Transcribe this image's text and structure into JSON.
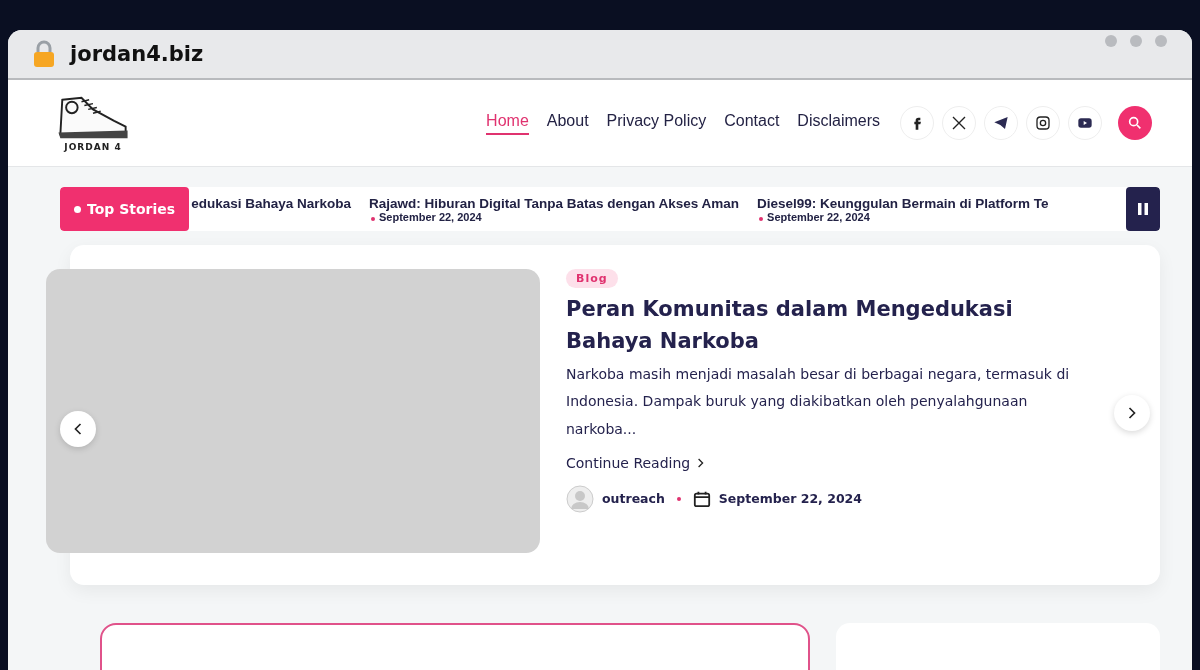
{
  "browser": {
    "address": "jordan4.biz"
  },
  "site": {
    "logo_text": "JORDAN 4"
  },
  "nav": [
    {
      "label": "Home",
      "selected": true
    },
    {
      "label": "About",
      "selected": false
    },
    {
      "label": "Privacy Policy",
      "selected": false
    },
    {
      "label": "Contact",
      "selected": false
    },
    {
      "label": "Disclaimers",
      "selected": false
    }
  ],
  "ticker": {
    "label": "Top Stories",
    "items": [
      {
        "title": "edukasi Bahaya Narkoba"
      },
      {
        "title": "Rajawd: Hiburan Digital Tanpa Batas dengan Akses Aman",
        "date": "September 22, 2024"
      },
      {
        "title": "Diesel99: Keunggulan Bermain di Platform Te",
        "date": "September 22, 2024"
      }
    ]
  },
  "featured": {
    "category": "Blog",
    "title": "Peran Komunitas dalam Mengedukasi Bahaya Narkoba",
    "excerpt": "Narkoba masih menjadi masalah besar di berbagai negara, termasuk di Indonesia. Dampak buruk yang diakibatkan oleh penyalahgunaan narkoba...",
    "link": "Continue Reading",
    "author": "outreach",
    "date": "September 22, 2024"
  }
}
